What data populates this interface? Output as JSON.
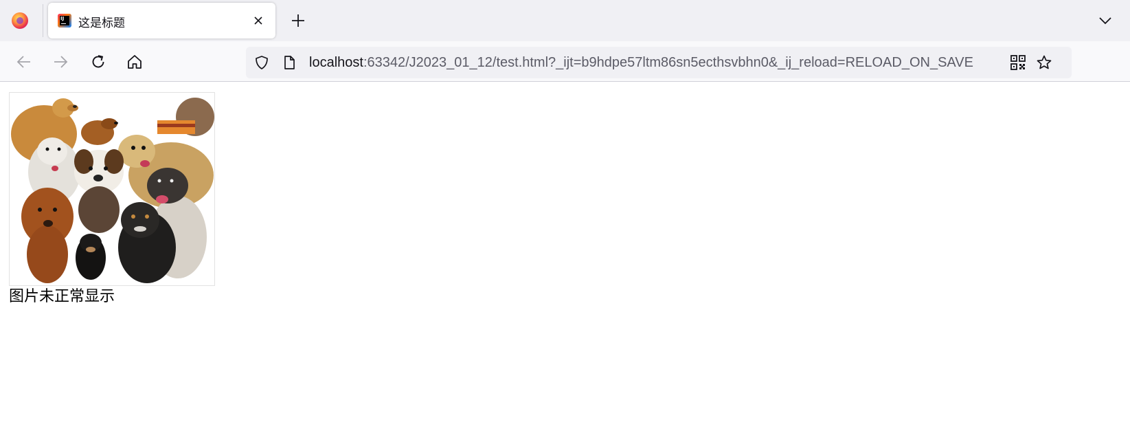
{
  "browser": {
    "tab": {
      "title": "这是标题",
      "favicon_name": "intellij-idea-favicon",
      "favicon_text": "IJ"
    },
    "urlbar": {
      "host": "localhost",
      "rest": ":63342/J2023_01_12/test.html?_ijt=b9hdpe57ltm86sn5ecthsvbhn0&_ij_reload=RELOAD_ON_SAVE"
    }
  },
  "page": {
    "image_alt": "图片未正常显示",
    "caption": "图片未正常显示"
  },
  "colors": {
    "tabstrip_bg": "#f0f0f4",
    "navbar_bg": "#f9f9fb",
    "urlbar_bg": "#f0f0f4",
    "text_primary": "#15141a",
    "text_secondary": "#5b5b66"
  }
}
